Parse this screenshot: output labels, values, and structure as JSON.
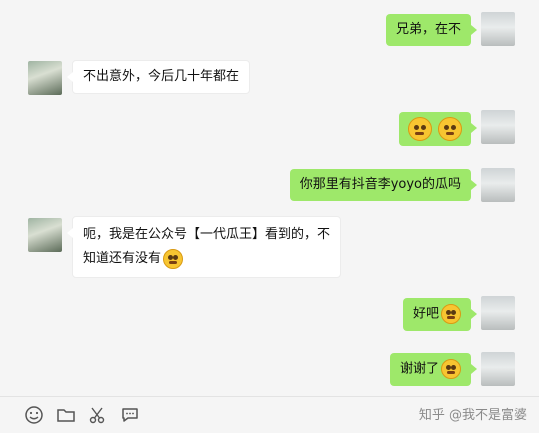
{
  "messages": [
    {
      "side": "me",
      "text": "兄弟，在不"
    },
    {
      "side": "other",
      "text": "不出意外，今后几十年都在"
    },
    {
      "side": "me",
      "text": ""
    },
    {
      "side": "me",
      "text": "你那里有抖音李yoyo的瓜吗"
    },
    {
      "side": "other",
      "line1": "呃，我是在公众号【一代瓜王】看到的，不",
      "line2": "知道还有没有"
    },
    {
      "side": "me",
      "text": "好吧"
    },
    {
      "side": "me",
      "text": "谢谢了"
    }
  ],
  "toolbar": {
    "icons": [
      "emoji-icon",
      "folder-icon",
      "scissors-icon",
      "chat-bubble-icon"
    ]
  },
  "watermark": "知乎 @我不是富婆",
  "colors": {
    "me_bubble": "#9ee86a",
    "other_bubble": "#ffffff",
    "background": "#f5f5f5"
  }
}
